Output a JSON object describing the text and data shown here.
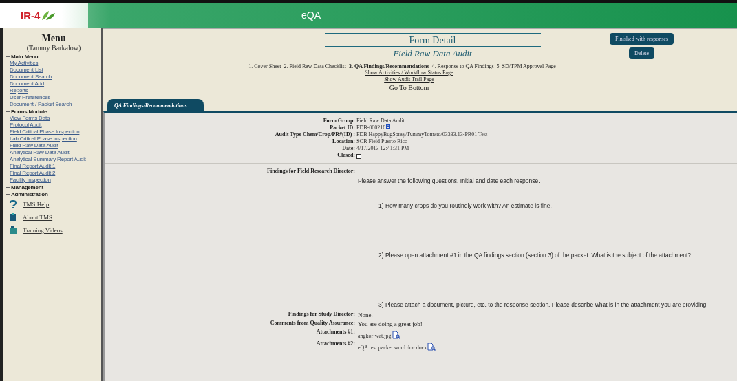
{
  "header": {
    "logo": "IR-4",
    "title": "eQA"
  },
  "sidebar": {
    "title": "Menu",
    "user": "(Tammy Barkalow)",
    "groups": [
      {
        "label": "Main Menu",
        "expanded": true,
        "items": [
          "My Activities",
          "Document List",
          "Document Search",
          "Document Add",
          "Reports",
          "User Preferences",
          "Document / Packet Search"
        ]
      },
      {
        "label": "Forms Module",
        "expanded": true,
        "items": [
          "View Forms Data",
          "Protocol Audit",
          "Field Critical Phase Inspection",
          "Lab Critical Phase Inspection",
          "Field Raw Data Audit",
          "Analytical Raw Data Audit",
          "Analytical Summary Report Audit",
          "Final Report Audit 1",
          "Final Report Audit 2",
          "Facility Inspection"
        ]
      },
      {
        "label": "Management",
        "expanded": false
      },
      {
        "label": "Administration",
        "expanded": false
      }
    ],
    "links": [
      {
        "kind": "help",
        "label": "TMS Help"
      },
      {
        "kind": "about",
        "label": "About TMS"
      },
      {
        "kind": "video",
        "label": "Training Videos"
      }
    ]
  },
  "form": {
    "title": "Form Detail",
    "subtitle": "Field Raw Data Audit",
    "steps": [
      {
        "label": "1. Cover Sheet",
        "selected": false
      },
      {
        "label": "2. Field Raw Data Checklist",
        "selected": false
      },
      {
        "label": "3. QA Findings/Recommendations",
        "selected": true
      },
      {
        "label": "4. Response to QA Findings",
        "selected": false
      },
      {
        "label": "5. SD/TPM Approval Page",
        "selected": false
      }
    ],
    "links": [
      "Show Activities / Workflow Status Page",
      "Show Audit Trail Page"
    ],
    "go_to_bottom": "Go To Bottom",
    "buttons": [
      "Finished with responses",
      "Delete"
    ]
  },
  "tab": {
    "label": "QA Findings/Recommendations"
  },
  "details": [
    {
      "label": "Form Group:",
      "value": "Field Raw Data Audit"
    },
    {
      "label": "Packet ID:",
      "value": "FDB-000216",
      "kind": "link"
    },
    {
      "label": "Audit Type Chem/Crop/PR#(ID) :",
      "value": "FDB HappyBugSpray/TummyTomato/03333.13-PR01 Test"
    },
    {
      "label": "Location:",
      "value": "SOR Field Puerto Rico"
    },
    {
      "label": "Date:",
      "value": "4/17/2013 12:41:31 PM"
    },
    {
      "label": "Closed:",
      "kind": "checkbox",
      "checked": false
    }
  ],
  "findings_frd": {
    "label": "Findings for Field Research Director:",
    "intro": "Please answer the following questions.  Initial and date each response.",
    "questions": [
      "1)  How many crops do you routinely work with?  An estimate is fine.",
      "2)  Please open attachment #1 in the QA findings section (section 3) of the packet.  What is the subject of the attachment?",
      "3)  Please attach a document, picture, etc. to the response section.  Please describe what is in the attachment you are providing."
    ]
  },
  "findings_sd": {
    "label": "Findings for Study Director:",
    "value": "None."
  },
  "comments": {
    "label": "Comments from Quality Assurance:",
    "value": "You are doing a great job!"
  },
  "attachments": [
    {
      "label": "Attachments #1:",
      "file": "angkor-wat.jpg"
    },
    {
      "label": "Attachments #2:",
      "file": "eQA test packet word doc.docx"
    }
  ]
}
